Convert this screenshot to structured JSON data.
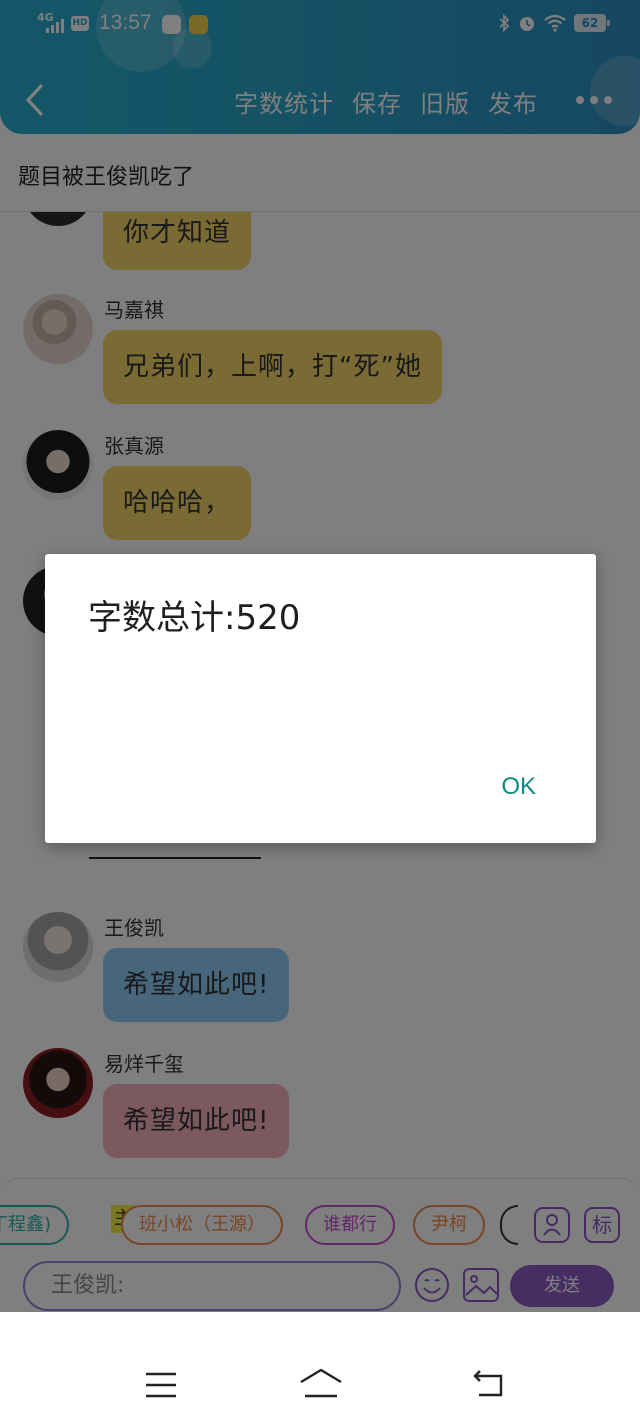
{
  "status_bar": {
    "network": "4G",
    "hd_badge": "HD",
    "time": "13:57",
    "battery": "62"
  },
  "nav": {
    "actions": [
      "字数统计",
      "保存",
      "旧版",
      "发布"
    ]
  },
  "story_title": "题目被王俊凯吃了",
  "messages": [
    {
      "sender": "",
      "text": "你才知道",
      "bubble_color": "#f4d66a"
    },
    {
      "sender": "马嘉祺",
      "text": "兄弟们，上啊，打“死”她",
      "bubble_color": "#f4d66a"
    },
    {
      "sender": "张真源",
      "text": "哈哈哈，",
      "bubble_color": "#f4d66a"
    },
    {
      "sender": "王俊凯",
      "text": "希望如此吧!",
      "bubble_color": "#8fcdf6"
    },
    {
      "sender": "易烊千玺",
      "text": "希望如此吧!",
      "bubble_color": "#f9b2c0"
    }
  ],
  "toolbar": {
    "characters": [
      {
        "name": "丁程鑫)",
        "color": "#2fb5a6"
      },
      {
        "name": "班小松（王源）",
        "color": "#f08a4b"
      },
      {
        "name": "谁都行",
        "color": "#c74fd0"
      },
      {
        "name": "尹柯",
        "color": "#f08a4b"
      }
    ],
    "narrator_tag": "主",
    "label_icon": "标",
    "input_value": "王俊凯:",
    "send_label": "发送"
  },
  "dialog": {
    "message": "字数总计:520",
    "ok_label": "OK"
  },
  "colors": {
    "header_start": "#27aed0",
    "header_end": "#2c8fc4",
    "accent_purple": "#8e5cc4",
    "dialog_ok": "#0f8a80"
  }
}
